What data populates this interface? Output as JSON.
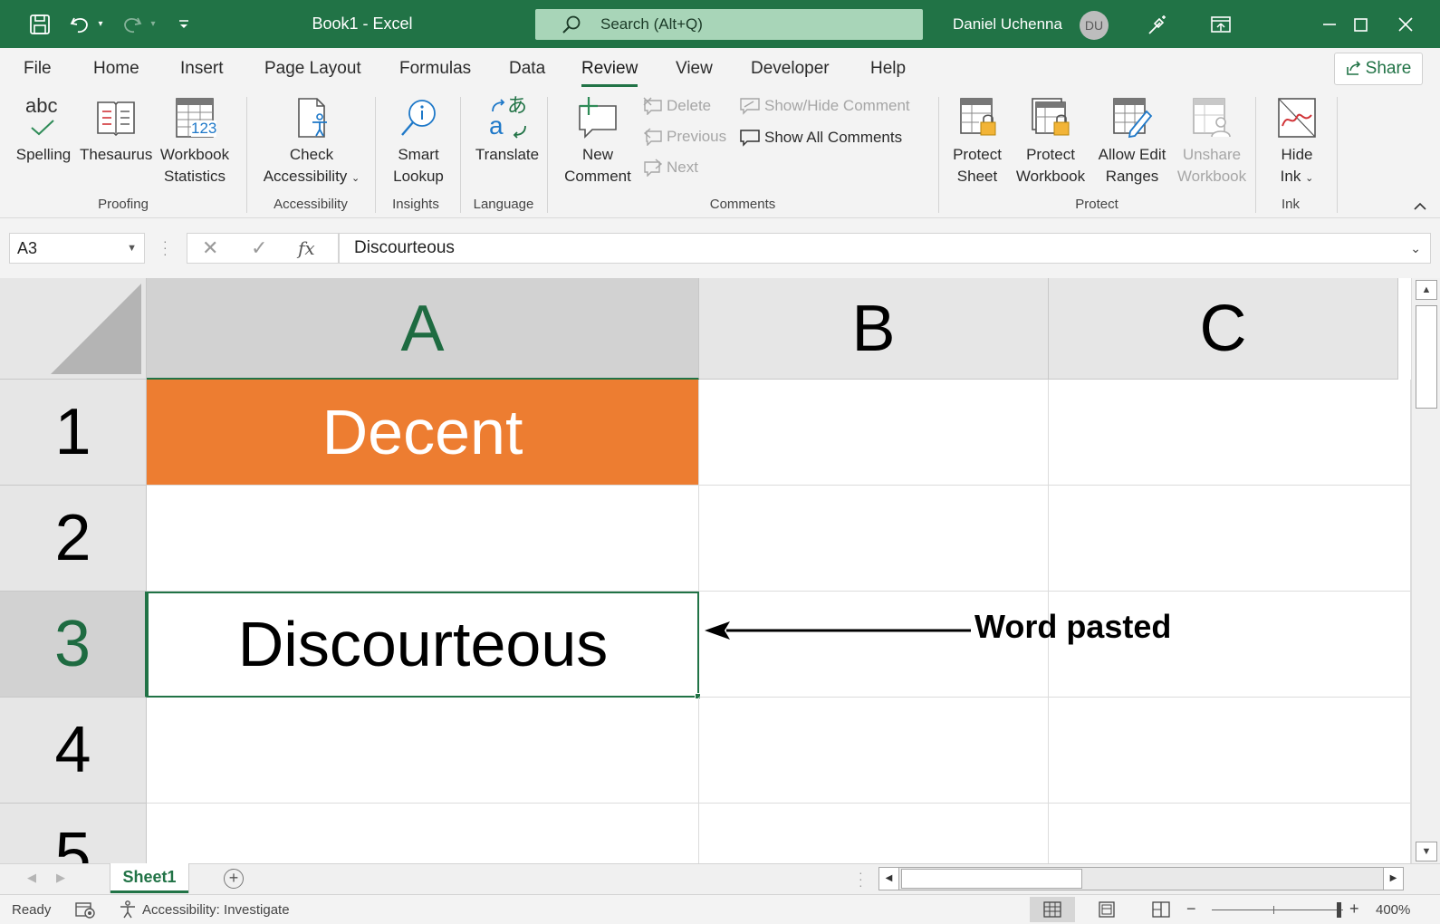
{
  "titlebar": {
    "doc_title": "Book1  -  Excel",
    "search_placeholder": "Search (Alt+Q)",
    "user_name": "Daniel Uchenna",
    "user_initials": "DU",
    "bg_color": "#217346"
  },
  "tabs": [
    "File",
    "Home",
    "Insert",
    "Page Layout",
    "Formulas",
    "Data",
    "Review",
    "View",
    "Developer",
    "Help"
  ],
  "active_tab": "Review",
  "share_label": "Share",
  "ribbon": {
    "proofing": {
      "label": "Proofing",
      "spelling": "Spelling",
      "spelling_icon_text": "abc",
      "thesaurus": "Thesaurus",
      "workbook_stats_1": "Workbook",
      "workbook_stats_2": "Statistics",
      "workbook_stats_icon_text": "123"
    },
    "accessibility": {
      "label": "Accessibility",
      "check_1": "Check",
      "check_2": "Accessibility"
    },
    "insights": {
      "label": "Insights",
      "smart_1": "Smart",
      "smart_2": "Lookup"
    },
    "language": {
      "label": "Language",
      "translate": "Translate"
    },
    "comments": {
      "label": "Comments",
      "new_1": "New",
      "new_2": "Comment",
      "delete": "Delete",
      "previous": "Previous",
      "next": "Next",
      "show_hide": "Show/Hide Comment",
      "show_all": "Show All Comments"
    },
    "protect": {
      "label": "Protect",
      "protect_sheet_1": "Protect",
      "protect_sheet_2": "Sheet",
      "protect_wb_1": "Protect",
      "protect_wb_2": "Workbook",
      "allow_edit_1": "Allow Edit",
      "allow_edit_2": "Ranges",
      "unshare_1": "Unshare",
      "unshare_2": "Workbook"
    },
    "ink": {
      "label": "Ink",
      "hide_1": "Hide",
      "hide_2": "Ink"
    }
  },
  "formula_bar": {
    "name_box": "A3",
    "fx_label": "fx",
    "formula_value": "Discourteous"
  },
  "grid": {
    "columns": [
      "A",
      "B",
      "C"
    ],
    "selected_column": "A",
    "rows": [
      "1",
      "2",
      "3",
      "4",
      "5"
    ],
    "selected_row": "3",
    "cells": {
      "A1": "Decent",
      "A3": "Discourteous"
    },
    "a1_fill_color": "#ed7d31",
    "annotation": "Word pasted"
  },
  "sheets": [
    "Sheet1"
  ],
  "active_sheet": "Sheet1",
  "statusbar": {
    "ready": "Ready",
    "accessibility": "Accessibility: Investigate",
    "zoom": "400%",
    "zoom_minus": "−",
    "zoom_plus": "+",
    "zoom_level_fraction": 1.0
  }
}
